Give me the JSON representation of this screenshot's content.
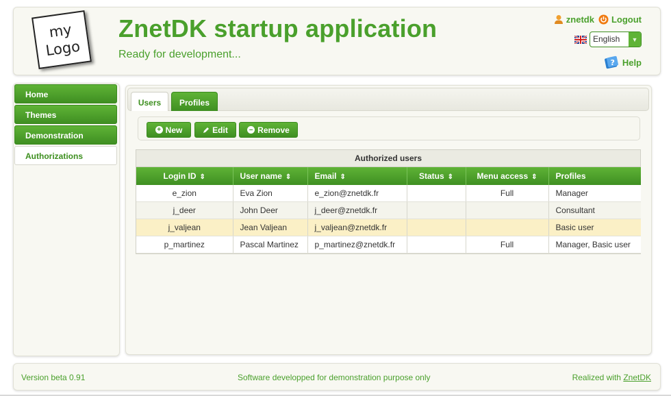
{
  "header": {
    "logo_line1": "my",
    "logo_line2": "Logo",
    "title": "ZnetDK startup application",
    "subtitle": "Ready for development...",
    "user_name": "znetdk",
    "logout_label": "Logout",
    "language": "English",
    "help_label": "Help"
  },
  "sidebar": {
    "items": [
      {
        "label": "Home"
      },
      {
        "label": "Themes"
      },
      {
        "label": "Demonstration"
      },
      {
        "label": "Authorizations"
      }
    ]
  },
  "main": {
    "tabs": [
      {
        "label": "Users"
      },
      {
        "label": "Profiles"
      }
    ],
    "toolbar": {
      "new_label": "New",
      "edit_label": "Edit",
      "remove_label": "Remove"
    },
    "grid": {
      "caption": "Authorized users",
      "columns": [
        "Login ID",
        "User name",
        "Email",
        "Status",
        "Menu access",
        "Profiles"
      ],
      "rows": [
        {
          "login": "e_zion",
          "name": "Eva Zion",
          "email": "e_zion@znetdk.fr",
          "status": "",
          "menu": "Full",
          "profiles": "Manager"
        },
        {
          "login": "j_deer",
          "name": "John Deer",
          "email": "j_deer@znetdk.fr",
          "status": "",
          "menu": "",
          "profiles": "Consultant"
        },
        {
          "login": "j_valjean",
          "name": "Jean Valjean",
          "email": "j_valjean@znetdk.fr",
          "status": "",
          "menu": "",
          "profiles": "Basic user"
        },
        {
          "login": "p_martinez",
          "name": "Pascal Martinez",
          "email": "p_martinez@znetdk.fr",
          "status": "",
          "menu": "Full",
          "profiles": "Manager, Basic user"
        }
      ]
    }
  },
  "footer": {
    "version": "Version beta 0.91",
    "notice": "Software developped for demonstration purpose only",
    "realized_prefix": "Realized with",
    "realized_link": "ZnetDK"
  },
  "colors": {
    "accent": "#4aa02c",
    "button": "#3f8f22",
    "selected_row": "#fbf0c6"
  },
  "icons": [
    "user-icon",
    "power-icon",
    "uk-flag-icon",
    "help-book-icon",
    "plus-circle-icon",
    "pencil-icon",
    "minus-circle-icon",
    "sort-icon"
  ]
}
